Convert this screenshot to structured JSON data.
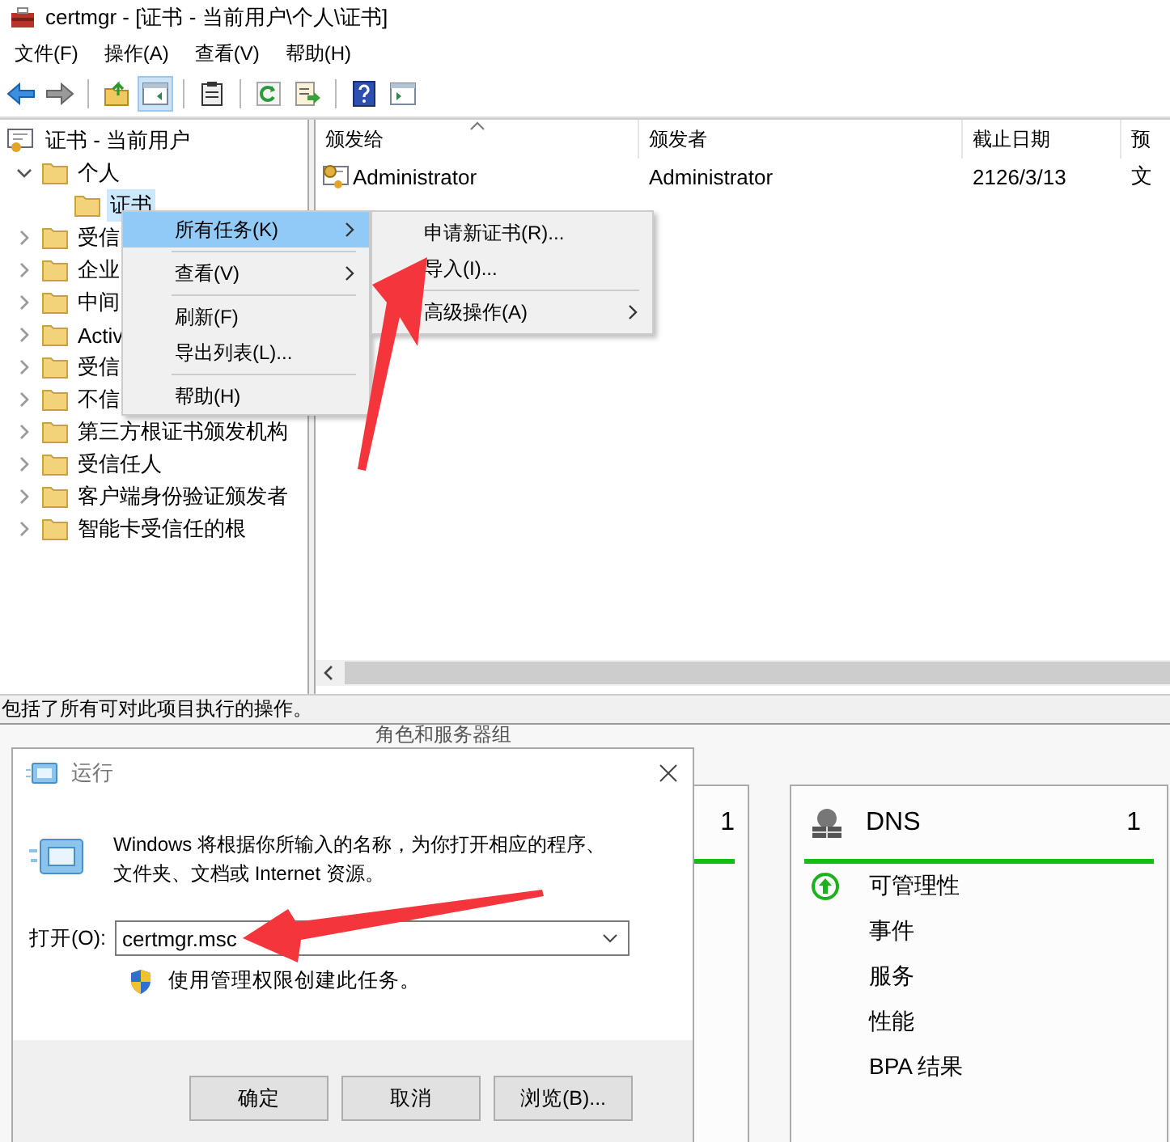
{
  "window": {
    "title": "certmgr - [证书 - 当前用户\\个人\\证书]"
  },
  "menu_bar": [
    "文件(F)",
    "操作(A)",
    "查看(V)",
    "帮助(H)"
  ],
  "toolbar": [
    {
      "kind": "back",
      "pressed": false
    },
    {
      "kind": "forward",
      "pressed": false
    },
    {
      "kind": "separator"
    },
    {
      "kind": "up",
      "pressed": false
    },
    {
      "kind": "tree_pane",
      "pressed": true
    },
    {
      "kind": "separator"
    },
    {
      "kind": "clipboard",
      "pressed": false
    },
    {
      "kind": "separator"
    },
    {
      "kind": "refresh",
      "pressed": false
    },
    {
      "kind": "export",
      "pressed": false
    },
    {
      "kind": "separator"
    },
    {
      "kind": "help",
      "pressed": false
    },
    {
      "kind": "action_pane",
      "pressed": false
    }
  ],
  "tree": {
    "label": "证书 - 当前用户",
    "selected": false,
    "children": [
      {
        "label": "个人",
        "expanded": true,
        "selected": false,
        "children": [
          {
            "label": "证书",
            "selected": true
          }
        ]
      },
      {
        "label": "受信",
        "expanded": false,
        "selected": false
      },
      {
        "label": "企业",
        "expanded": false,
        "selected": false
      },
      {
        "label": "中间",
        "expanded": false,
        "selected": false
      },
      {
        "label": "Activ",
        "expanded": false,
        "selected": false
      },
      {
        "label": "受信",
        "expanded": false,
        "selected": false
      },
      {
        "label": "不信",
        "expanded": false,
        "selected": false
      },
      {
        "label": "第三方根证书颁发机构",
        "expanded": false,
        "selected": false
      },
      {
        "label": "受信任人",
        "expanded": false,
        "selected": false
      },
      {
        "label": "客户端身份验证颁发者",
        "expanded": false,
        "selected": false
      },
      {
        "label": "智能卡受信任的根",
        "expanded": false,
        "selected": false
      }
    ]
  },
  "list": {
    "columns": [
      {
        "label": "颁发给",
        "sorted": true
      },
      {
        "label": "颁发者",
        "sorted": false
      },
      {
        "label": "截止日期",
        "sorted": false
      },
      {
        "label": "预",
        "sorted": false
      }
    ],
    "rows": [
      {
        "cells": [
          "Administrator",
          "Administrator",
          "2126/3/13",
          "文"
        ]
      }
    ]
  },
  "status_bar": "包括了所有可对此项目执行的操作。",
  "context_menu": {
    "items": [
      {
        "kind": "item",
        "label": "所有任务(K)",
        "selected": true,
        "submenu": true
      },
      {
        "kind": "separator"
      },
      {
        "kind": "item",
        "label": "查看(V)",
        "selected": false,
        "submenu": true
      },
      {
        "kind": "separator"
      },
      {
        "kind": "item",
        "label": "刷新(F)",
        "selected": false,
        "submenu": false
      },
      {
        "kind": "item",
        "label": "导出列表(L)...",
        "selected": false,
        "submenu": false
      },
      {
        "kind": "separator"
      },
      {
        "kind": "item",
        "label": "帮助(H)",
        "selected": false,
        "submenu": false
      }
    ]
  },
  "submenu": {
    "items": [
      {
        "kind": "item",
        "label": "申请新证书(R)...",
        "selected": false,
        "submenu": false
      },
      {
        "kind": "item",
        "label": "导入(I)...",
        "selected": false,
        "submenu": false
      },
      {
        "kind": "separator"
      },
      {
        "kind": "item",
        "label": "高级操作(A)",
        "selected": false,
        "submenu": true
      }
    ]
  },
  "server_manager": {
    "heading": "角色和服务器组",
    "tiles": [
      {
        "count": "1"
      },
      {
        "name": "DNS",
        "count": "1",
        "items": [
          {
            "kind": "status",
            "label": "可管理性"
          },
          {
            "kind": "plain",
            "label": "事件"
          },
          {
            "kind": "plain",
            "label": "服务"
          },
          {
            "kind": "plain",
            "label": "性能"
          },
          {
            "kind": "plain",
            "label": "BPA 结果"
          }
        ]
      }
    ]
  },
  "run_dialog": {
    "title": "运行",
    "description": "Windows 将根据你所输入的名称，为你打开相应的程序、文件夹、文档或 Internet 资源。",
    "open_label": "打开(O):",
    "value": "certmgr.msc",
    "admin_note": "使用管理权限创建此任务。",
    "buttons": [
      "确定",
      "取消",
      "浏览(B)..."
    ]
  }
}
